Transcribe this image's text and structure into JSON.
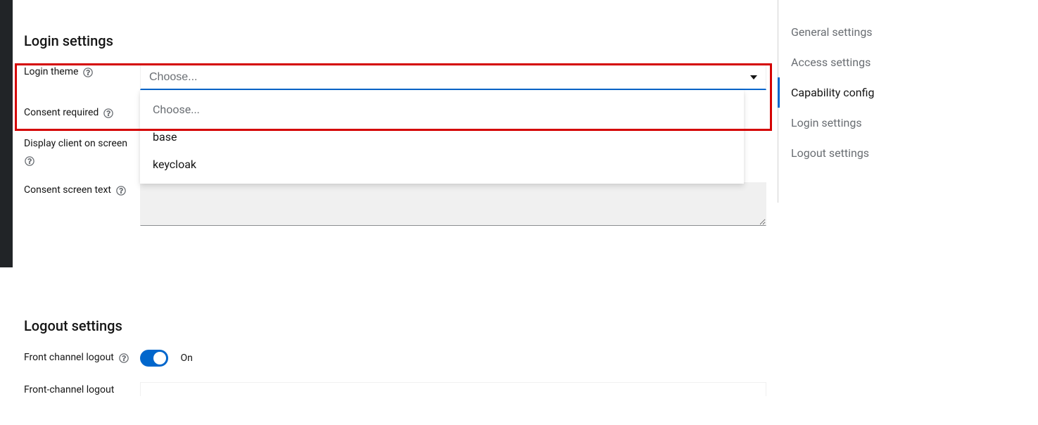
{
  "sidebar": {
    "items": [
      {
        "label": "General settings",
        "active": false
      },
      {
        "label": "Access settings",
        "active": false
      },
      {
        "label": "Capability config",
        "active": true
      },
      {
        "label": "Login settings",
        "active": false
      },
      {
        "label": "Logout settings",
        "active": false
      }
    ]
  },
  "loginSettings": {
    "title": "Login settings",
    "loginTheme": {
      "label": "Login theme",
      "selected": "Choose...",
      "options": [
        "Choose...",
        "base",
        "keycloak"
      ]
    },
    "consentRequired": {
      "label": "Consent required"
    },
    "displayClient": {
      "label": "Display client on screen"
    },
    "consentScreenText": {
      "label": "Consent screen text",
      "value": ""
    }
  },
  "logoutSettings": {
    "title": "Logout settings",
    "frontChannelLogout": {
      "label": "Front channel logout",
      "value": "On"
    },
    "frontChannelLogoutUrl": {
      "label": "Front-channel logout"
    }
  }
}
